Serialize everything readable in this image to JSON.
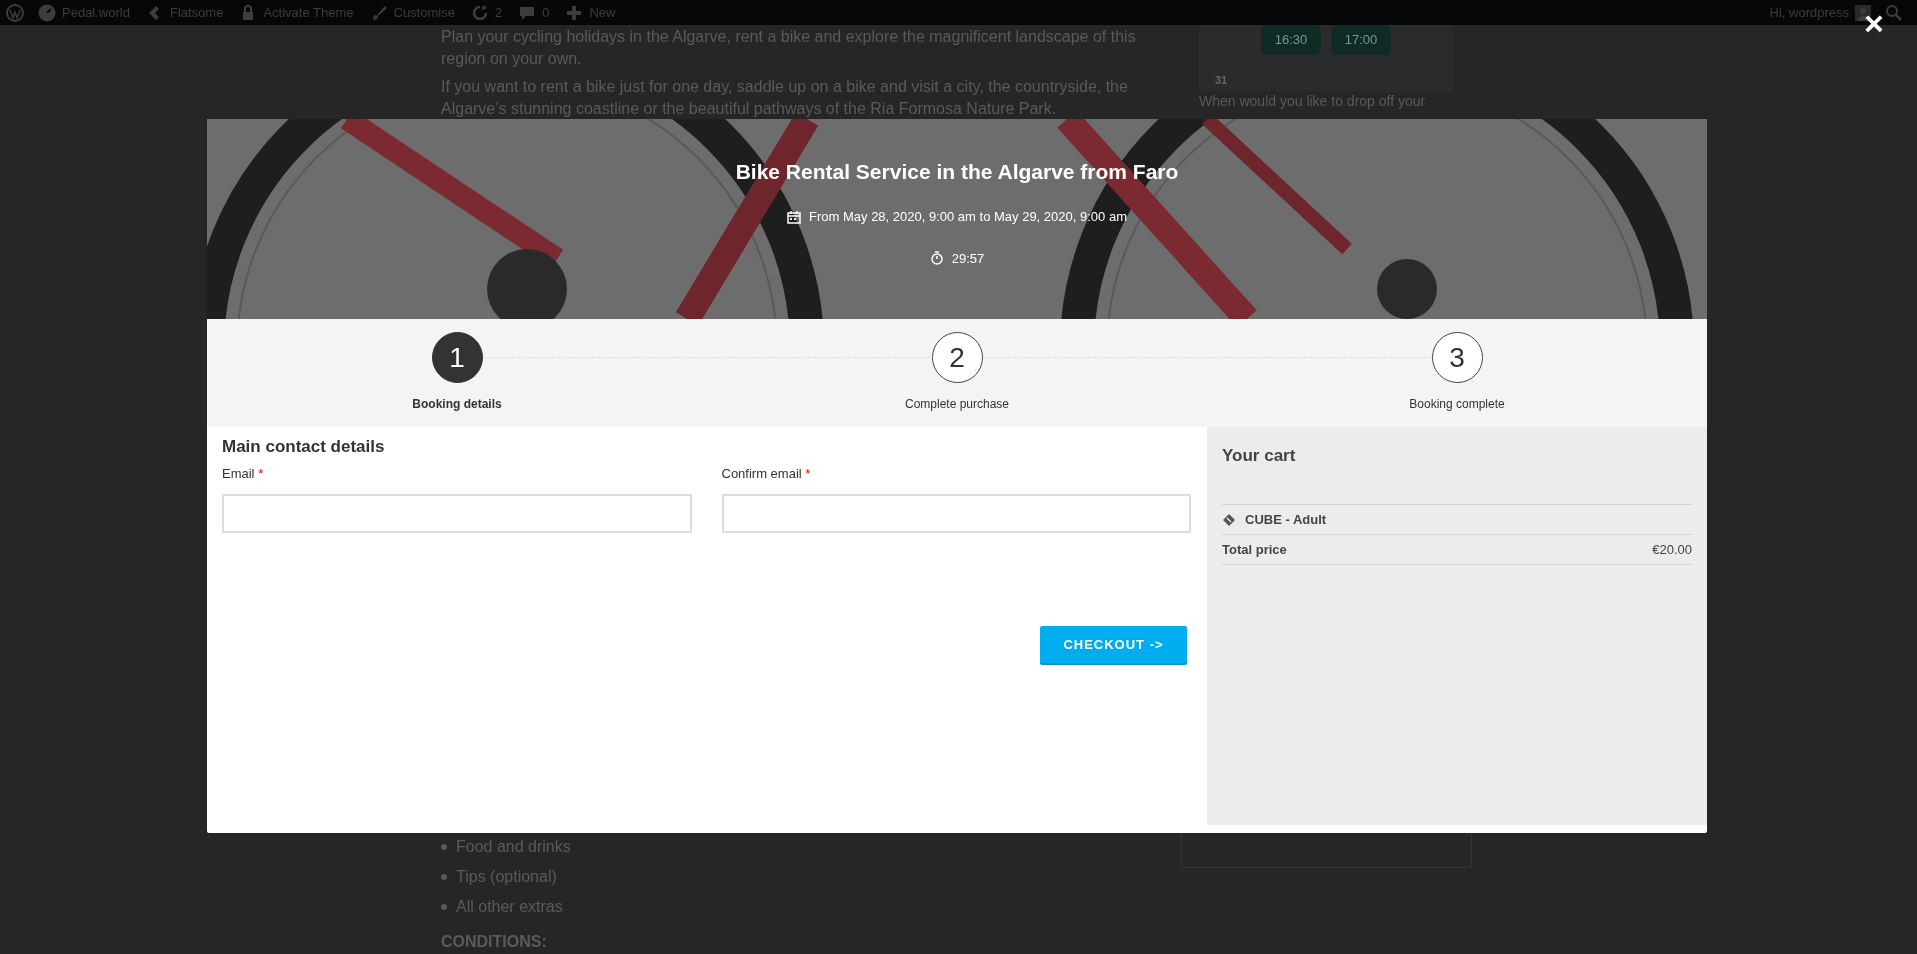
{
  "admin_bar": {
    "items": [
      {
        "label": "Pedal.world"
      },
      {
        "label": "Flatsome"
      },
      {
        "label": "Activate Theme"
      },
      {
        "label": "Customise"
      },
      {
        "label": "2"
      },
      {
        "label": "0"
      },
      {
        "label": "New"
      }
    ],
    "greeting": "Hi, wordpress"
  },
  "page": {
    "paragraphs": [
      "Plan your cycling holidays in the Algarve, rent a bike and explore the magnificent landscape of this region on your own.",
      "If you want to rent a bike just for one day, saddle up on a bike and visit a city, the countryside, the Algarve’s stunning coastline or the beautiful pathways of the Ria Formosa Nature Park."
    ],
    "list": [
      "Food and drinks",
      "Tips (optional)",
      "All other extras"
    ],
    "heading": "CONDITIONS:",
    "sidebar": {
      "times": [
        "16:30",
        "17:00"
      ],
      "day": "31",
      "question": "When would you like to drop off your"
    }
  },
  "modal": {
    "close": "×",
    "title": "Bike Rental Service in the Algarve from Faro",
    "dates": "From May 28, 2020, 9:00 am to May 29, 2020, 9:00 am",
    "timer": "29:57",
    "steps": [
      {
        "number": "1",
        "label": "Booking details",
        "selected": true
      },
      {
        "number": "2",
        "label": "Complete purchase",
        "selected": false
      },
      {
        "number": "3",
        "label": "Booking complete",
        "selected": false
      }
    ],
    "form": {
      "heading": "Main contact details",
      "fields": [
        {
          "label": "Email",
          "required_mark": "*"
        },
        {
          "label": "Confirm email",
          "required_mark": "*"
        }
      ],
      "button": "CHECKOUT ->"
    },
    "cart": {
      "title": "Your cart",
      "items": [
        {
          "name": "CUBE - Adult"
        }
      ],
      "total": {
        "label": "Total price",
        "value": "€20.00"
      }
    }
  }
}
